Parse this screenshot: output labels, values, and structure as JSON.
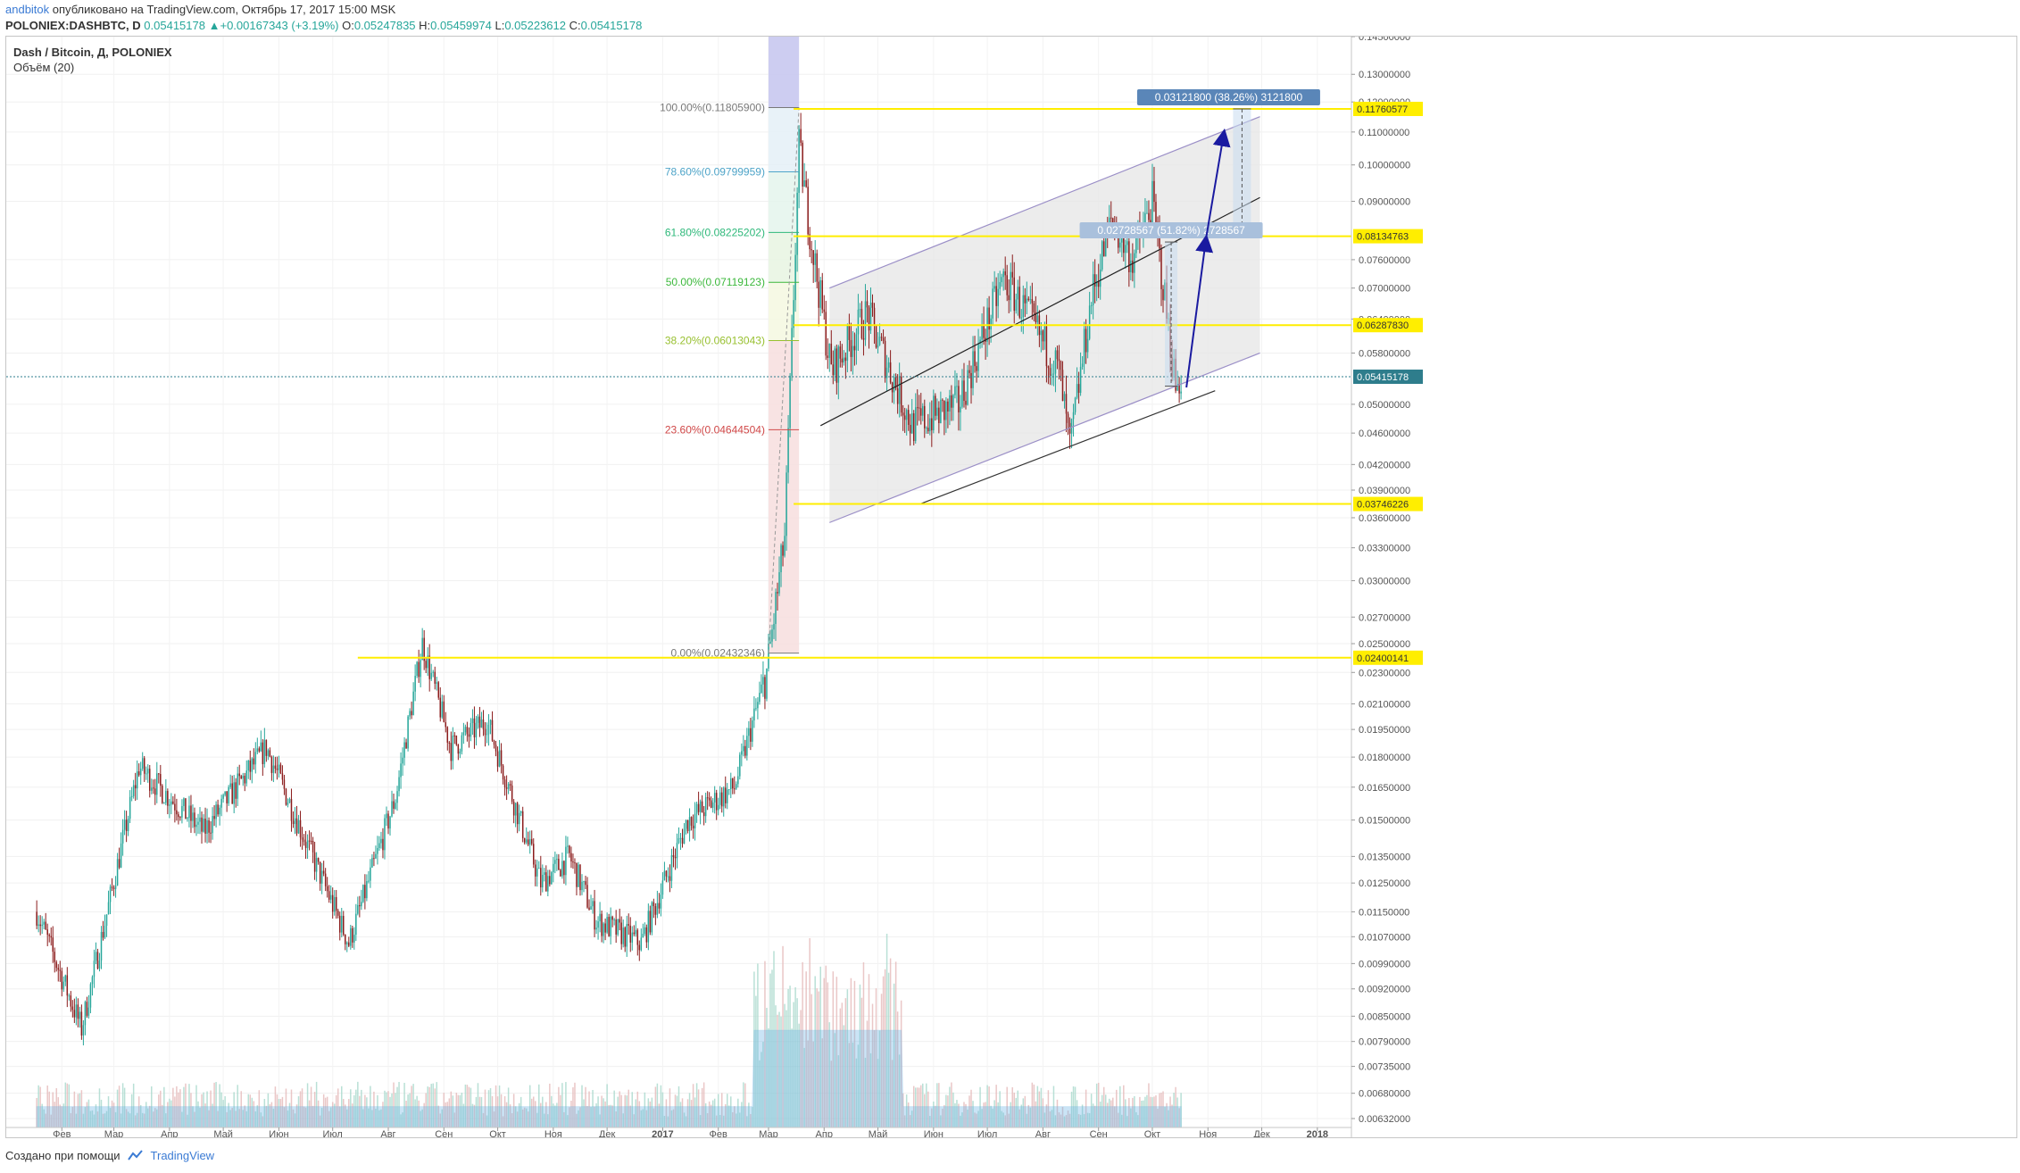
{
  "header": {
    "author": "andbitok",
    "published_text": "опубликовано на TradingView.com, Октябрь 17, 2017 15:00 MSK",
    "symbol": "POLONIEX:DASHBTC, D",
    "price": "0.05415178",
    "change": "+0.00167343 (+3.19%)",
    "open_label": "O:",
    "open": "0.05247835",
    "high_label": "H:",
    "high": "0.05459974",
    "low_label": "L:",
    "low": "0.05223612",
    "close_label": "C:",
    "close": "0.05415178"
  },
  "legend": {
    "title": "Dash / Bitcoin, Д, POLONIEX",
    "volume": "Объём (20)"
  },
  "footer": {
    "created_with": "Создано при помощи",
    "brand": "TradingView"
  },
  "colors": {
    "up": "#26a69a",
    "down": "#8b1c1c",
    "hline": "#ffee00",
    "channel": "#9b8fc7",
    "channel_fill": "#e6e6e6",
    "projection_arrow": "#1a1aa0",
    "measure_box": "#c8dcf0",
    "volume_area": "#6ab4e6",
    "last_price": "#2e7d8c"
  },
  "chart_data": {
    "type": "candlestick",
    "symbol": "DASHBTC",
    "exchange": "POLONIEX",
    "interval": "1D",
    "y_scale": "log",
    "ylim": [
      0.00632,
      0.145
    ],
    "y_ticks": [
      "0.14500000",
      "0.13000000",
      "0.12000000",
      "0.11000000",
      "0.10000000",
      "0.09000000",
      "0.07600000",
      "0.07000000",
      "0.06400000",
      "0.05800000",
      "0.05000000",
      "0.04600000",
      "0.04200000",
      "0.03900000",
      "0.03600000",
      "0.03300000",
      "0.03000000",
      "0.02700000",
      "0.02500000",
      "0.02300000",
      "0.02100000",
      "0.01950000",
      "0.01800000",
      "0.01650000",
      "0.01500000",
      "0.01350000",
      "0.01250000",
      "0.01150000",
      "0.01070000",
      "0.00990000",
      "0.00920000",
      "0.00850000",
      "0.00790000",
      "0.00735000",
      "0.00680000",
      "0.00632000"
    ],
    "x_ticks": [
      "Фев",
      "Мар",
      "Апр",
      "Май",
      "Июн",
      "Июл",
      "Авг",
      "Сен",
      "Окт",
      "Ноя",
      "Дек",
      "2017",
      "Фев",
      "Мар",
      "Апр",
      "Май",
      "Июн",
      "Июл",
      "Авг",
      "Сен",
      "Окт",
      "Ноя",
      "Дек",
      "2018"
    ],
    "key_prices": [
      {
        "date": "2016-01-18",
        "price": 0.0115
      },
      {
        "date": "2016-02-12",
        "price": 0.0082
      },
      {
        "date": "2016-03-15",
        "price": 0.0175
      },
      {
        "date": "2016-04-20",
        "price": 0.0145
      },
      {
        "date": "2016-05-25",
        "price": 0.0185
      },
      {
        "date": "2016-07-10",
        "price": 0.0105
      },
      {
        "date": "2016-08-05",
        "price": 0.016
      },
      {
        "date": "2016-08-20",
        "price": 0.025
      },
      {
        "date": "2016-09-05",
        "price": 0.0185
      },
      {
        "date": "2016-09-25",
        "price": 0.02
      },
      {
        "date": "2016-10-25",
        "price": 0.0125
      },
      {
        "date": "2016-11-10",
        "price": 0.0135
      },
      {
        "date": "2016-11-25",
        "price": 0.0112
      },
      {
        "date": "2016-12-20",
        "price": 0.0105
      },
      {
        "date": "2017-01-15",
        "price": 0.015
      },
      {
        "date": "2017-02-10",
        "price": 0.0165
      },
      {
        "date": "2017-02-28",
        "price": 0.023
      },
      {
        "date": "2017-03-10",
        "price": 0.034
      },
      {
        "date": "2017-03-18",
        "price": 0.105
      },
      {
        "date": "2017-03-25",
        "price": 0.08
      },
      {
        "date": "2017-04-05",
        "price": 0.055
      },
      {
        "date": "2017-04-25",
        "price": 0.065
      },
      {
        "date": "2017-05-20",
        "price": 0.047
      },
      {
        "date": "2017-06-15",
        "price": 0.05
      },
      {
        "date": "2017-07-10",
        "price": 0.072
      },
      {
        "date": "2017-07-25",
        "price": 0.064
      },
      {
        "date": "2017-08-10",
        "price": 0.055
      },
      {
        "date": "2017-08-16",
        "price": 0.044
      },
      {
        "date": "2017-08-28",
        "price": 0.068
      },
      {
        "date": "2017-09-08",
        "price": 0.085
      },
      {
        "date": "2017-09-20",
        "price": 0.076
      },
      {
        "date": "2017-10-01",
        "price": 0.09
      },
      {
        "date": "2017-10-09",
        "price": 0.065
      },
      {
        "date": "2017-10-14",
        "price": 0.0525
      },
      {
        "date": "2017-10-17",
        "price": 0.05415178
      }
    ],
    "last_price": "0.05415178",
    "horizontal_levels": [
      {
        "label": "0.11760577",
        "price": 0.11760577
      },
      {
        "label": "0.08134763",
        "price": 0.08134763
      },
      {
        "label": "0.06287830",
        "price": 0.0628783
      },
      {
        "label": "0.03746226",
        "price": 0.03746226
      },
      {
        "label": "0.02400141",
        "price": 0.02400141
      }
    ],
    "fibonacci": {
      "from": {
        "date": "2017-03-01",
        "price": 0.02432346
      },
      "to": {
        "date": "2017-03-18",
        "price": 0.118059
      },
      "levels": [
        {
          "label": "100.00%(0.11805900)",
          "ratio": 1.0,
          "price": 0.118059,
          "color": "#787878",
          "fill": "#c8c8f0"
        },
        {
          "label": "78.60%(0.09799959)",
          "ratio": 0.786,
          "price": 0.09799959,
          "color": "#4ea4c8",
          "fill": "#e4f0f7"
        },
        {
          "label": "61.80%(0.08225202)",
          "ratio": 0.618,
          "price": 0.08225202,
          "color": "#2eb87a",
          "fill": "#e4f5ec"
        },
        {
          "label": "50.00%(0.07119123)",
          "ratio": 0.5,
          "price": 0.07119123,
          "color": "#3cb83c",
          "fill": "#e8f5e2"
        },
        {
          "label": "38.20%(0.06013043)",
          "ratio": 0.382,
          "price": 0.06013043,
          "color": "#98c030",
          "fill": "#f5f8e0"
        },
        {
          "label": "23.60%(0.04644504)",
          "ratio": 0.236,
          "price": 0.04644504,
          "color": "#d04848",
          "fill": "#f7dede"
        },
        {
          "label": "0.00%(0.02432346)",
          "ratio": 0.0,
          "price": 0.02432346,
          "color": "#787878",
          "fill": "#f7dede"
        }
      ]
    },
    "channel": {
      "lower_start": {
        "date": "2017-04-04",
        "price": 0.0355
      },
      "lower_end": {
        "date": "2017-11-30",
        "price": 0.058
      },
      "upper_start": {
        "date": "2017-04-04",
        "price": 0.07
      },
      "upper_end": {
        "date": "2017-11-30",
        "price": 0.115
      },
      "mid_start": {
        "date": "2017-03-30",
        "price": 0.047
      },
      "mid_end": {
        "date": "2017-11-30",
        "price": 0.091
      },
      "support_start": {
        "date": "2017-05-25",
        "price": 0.0375
      },
      "support_end": {
        "date": "2017-11-05",
        "price": 0.052
      }
    },
    "measures": [
      {
        "label": "0.03121800 (38.26%) 3121800",
        "date_from": "2017-11-15",
        "date_to": "2017-11-25",
        "price_from": 0.0813,
        "price_to": 0.1176
      },
      {
        "label": "0.02728567 (51.82%) 2728567",
        "date_from": "2017-10-08",
        "date_to": "2017-10-15",
        "price_from": 0.0527,
        "price_to": 0.08
      }
    ],
    "projection": [
      {
        "date": "2017-10-20",
        "price": 0.0525
      },
      {
        "date": "2017-10-31",
        "price": 0.081
      },
      {
        "date": "2017-11-10",
        "price": 0.11
      }
    ],
    "volume_label": "Объём (20)"
  }
}
